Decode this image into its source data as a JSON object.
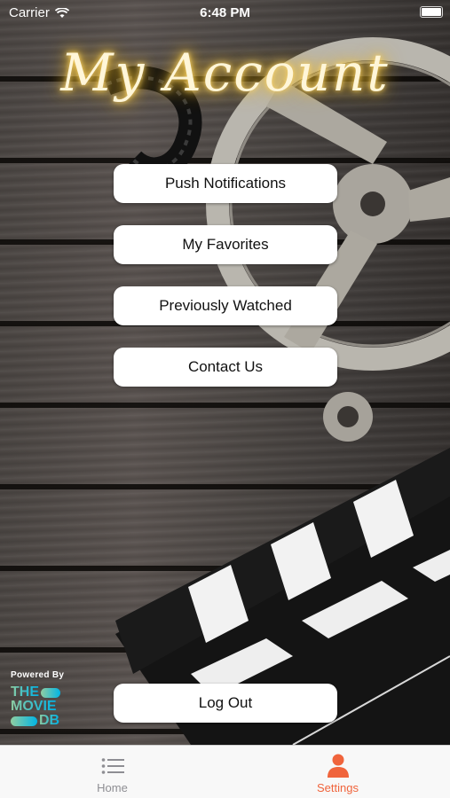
{
  "status_bar": {
    "carrier": "Carrier",
    "time": "6:48 PM"
  },
  "header": {
    "title": "My Account"
  },
  "menu": {
    "push_notifications": "Push Notifications",
    "my_favorites": "My Favorites",
    "previously_watched": "Previously Watched",
    "contact_us": "Contact Us",
    "log_out": "Log Out"
  },
  "attribution": {
    "powered_by": "Powered By",
    "logo_line1": "THE",
    "logo_line2": "MOVIE",
    "logo_line3": "DB"
  },
  "tab_bar": {
    "tabs": [
      {
        "label": "Home",
        "icon": "list-icon",
        "active": false
      },
      {
        "label": "Settings",
        "icon": "person-icon",
        "active": true
      }
    ]
  },
  "colors": {
    "accent": "#f0643c",
    "inactive": "#8e8e93",
    "title_glow": "#f1c232"
  }
}
